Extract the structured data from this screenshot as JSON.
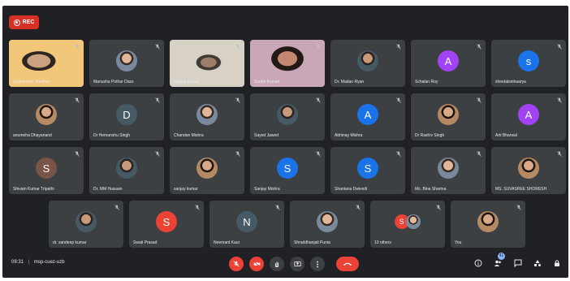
{
  "recording": {
    "label": "REC"
  },
  "tiles_row1": [
    {
      "name": "Sudhanshu Shekhar",
      "kind": "video",
      "initial": ""
    },
    {
      "name": "Manusha Pothar Dass",
      "kind": "photo",
      "initial": ""
    },
    {
      "name": "Sanjay Kumar",
      "kind": "video2",
      "initial": ""
    },
    {
      "name": "Sunita Kumari",
      "kind": "video3",
      "initial": ""
    },
    {
      "name": "Dr. Madan Ryan",
      "kind": "photo3",
      "initial": ""
    },
    {
      "name": "Schalan Roy",
      "kind": "letter",
      "initial": "A",
      "color": "#a142f4"
    },
    {
      "name": "sheetalsinhaarya",
      "kind": "letter",
      "initial": "s",
      "color": "#1a73e8"
    }
  ],
  "tiles_row2": [
    {
      "name": "anumeha Dhayanand",
      "kind": "photo2",
      "initial": ""
    },
    {
      "name": "Dr Hemanshu Singh",
      "kind": "letter",
      "initial": "D",
      "color": "#455a64"
    },
    {
      "name": "Chandan Mishra",
      "kind": "photo",
      "initial": ""
    },
    {
      "name": "Sayed Jawed",
      "kind": "photo3",
      "initial": ""
    },
    {
      "name": "Abhinay Mishra",
      "kind": "letter",
      "initial": "A",
      "color": "#1a73e8"
    },
    {
      "name": "Dr Rashiv Singh",
      "kind": "photo2",
      "initial": ""
    },
    {
      "name": "Arti Bharwal",
      "kind": "letter",
      "initial": "A",
      "color": "#a142f4"
    }
  ],
  "tiles_row3": [
    {
      "name": "Shivam Kumar Tripathi",
      "kind": "letter",
      "initial": "S",
      "color": "#795548"
    },
    {
      "name": "Dr. MM Hussain",
      "kind": "photo3",
      "initial": ""
    },
    {
      "name": "sanjay kumar",
      "kind": "photo2",
      "initial": ""
    },
    {
      "name": "Sanjay Mishra",
      "kind": "letter",
      "initial": "S",
      "color": "#1a73e8"
    },
    {
      "name": "Shantanu Dwivedi",
      "kind": "letter",
      "initial": "S",
      "color": "#1a73e8"
    },
    {
      "name": "Ms. Bina Sharma",
      "kind": "photo",
      "initial": ""
    },
    {
      "name": "MS. SUVASREE SHORESH",
      "kind": "photo2",
      "initial": ""
    }
  ],
  "tiles_row4": [
    {
      "name": "dr. sandeep kumar",
      "kind": "photo3",
      "initial": ""
    },
    {
      "name": "Swati Prasad",
      "kind": "letter",
      "initial": "S",
      "color": "#ea4335"
    },
    {
      "name": "Neemant Kaur",
      "kind": "letter",
      "initial": "N",
      "color": "#455a64"
    },
    {
      "name": "Shraddhanjali Punia",
      "kind": "photo",
      "initial": ""
    },
    {
      "name": "10 others",
      "kind": "others",
      "initial": "S",
      "color": "#ea4335"
    },
    {
      "name": "You",
      "kind": "photo2",
      "initial": ""
    }
  ],
  "bottom": {
    "time": "09:31",
    "meeting_code": "msp-cuez-uzb",
    "separator": "|",
    "participants_badge": "41"
  }
}
